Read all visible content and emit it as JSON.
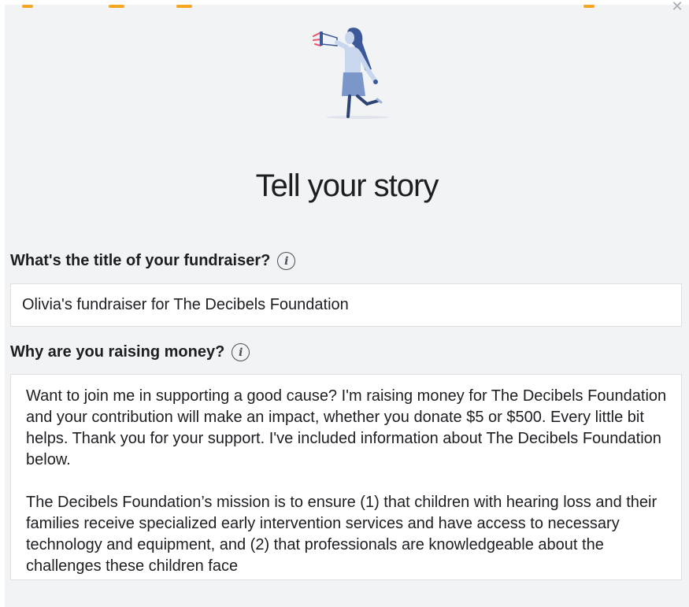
{
  "dialog": {
    "close_icon": "close-icon",
    "heading": "Tell your story",
    "accent_color": "#f5a623"
  },
  "title_field": {
    "label": "What's the title of your fundraiser?",
    "info_icon": "info-icon",
    "value": "Olivia's fundraiser for The Decibels Foundation"
  },
  "story_field": {
    "label": "Why are you raising money?",
    "info_icon": "info-icon",
    "paragraphs": [
      "Want to join me in supporting a good cause? I'm raising money for The Decibels Foundation and your contribution will make an impact, whether you donate $5 or $500. Every little bit helps. Thank you for your support. I've included information about The Decibels Foundation below.",
      "The Decibels Foundation’s mission is to ensure (1) that children with hearing loss and their families receive specialized early intervention services and have access to necessary technology and equipment, and (2) that professionals are knowledgeable about the challenges these children face"
    ]
  },
  "illustration": {
    "icon": "megaphone-person-illustration",
    "colors": {
      "hair": "#3b5998",
      "shirt": "#c8d6ee",
      "skirt": "#7b96c8",
      "megaphone": "#eef2fa",
      "sound_lines": "#f25268"
    }
  }
}
